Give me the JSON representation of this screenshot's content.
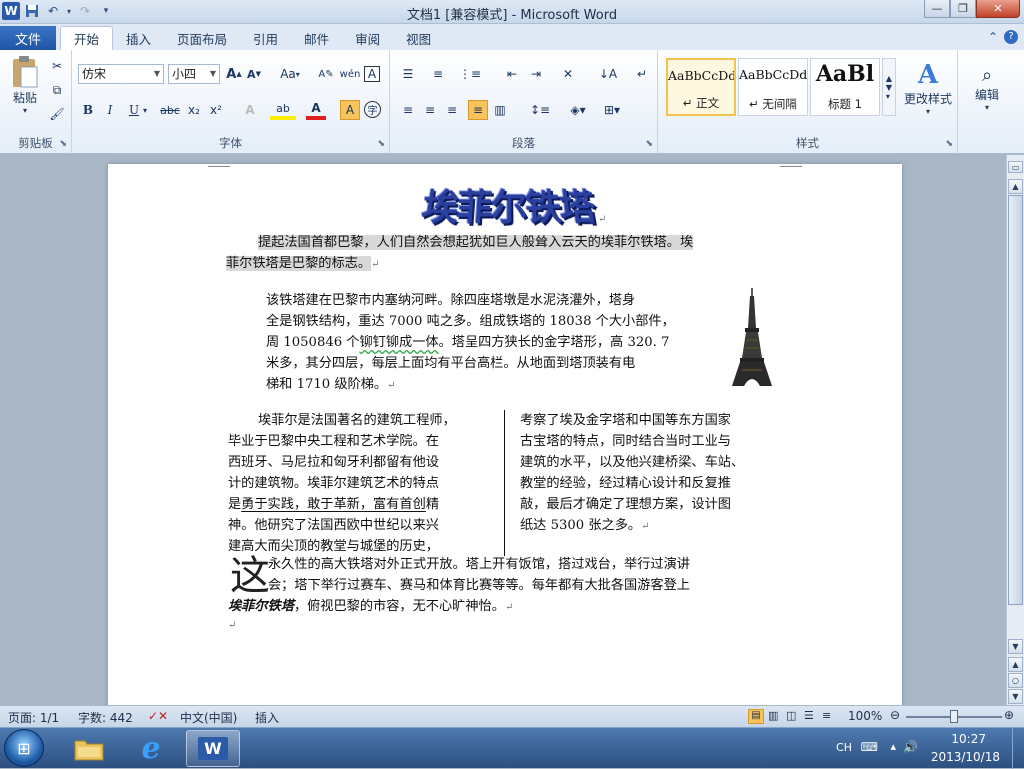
{
  "titlebar": {
    "title": "文档1 [兼容模式] - Microsoft Word",
    "app_letter": "W",
    "qat_icons": [
      "save-icon",
      "undo-icon",
      "redo-icon",
      "customize-icon"
    ]
  },
  "tabs": {
    "file": "文件",
    "items": [
      "开始",
      "插入",
      "页面布局",
      "引用",
      "邮件",
      "审阅",
      "视图"
    ],
    "active": "开始"
  },
  "ribbon": {
    "clipboard": {
      "label": "剪贴板",
      "paste": "粘贴"
    },
    "font": {
      "label": "字体",
      "font_name": "仿宋",
      "font_size": "小四",
      "grow": "A",
      "shrink": "A",
      "case": "Aa",
      "phonetic": "wén",
      "border_char": "A",
      "bold": "B",
      "italic": "I",
      "underline": "U",
      "strike": "abc",
      "subscript": "x₂",
      "superscript": "x²",
      "text_effect": "A",
      "highlight": "ab",
      "font_color": "A",
      "char_shading": "A",
      "enclose": "字"
    },
    "paragraph": {
      "label": "段落"
    },
    "styles": {
      "label": "样式",
      "items": [
        {
          "sample": "AaBbCcDd",
          "name": "↵ 正文"
        },
        {
          "sample": "AaBbCcDd",
          "name": "↵ 无间隔"
        },
        {
          "sample": "AaBl",
          "name": "标题 1"
        }
      ],
      "change_styles": "更改样式"
    },
    "editing": {
      "label": "编辑"
    }
  },
  "document": {
    "wordart_title": "埃菲尔铁塔",
    "para1_line1": "提起法国首都巴黎，人们自然会想起犹如巨人般耸入云天的埃菲尔铁塔。埃",
    "para1_line2": "菲尔铁塔是巴黎的标志。",
    "para2_lines": [
      "该铁塔建在巴黎市内塞纳河畔。除四座塔墩是水泥浇灌外，塔身",
      "全是钢铁结构，重达 7000 吨之多。组成铁塔的 18038 个大小部件，",
      "米多，其分四层，每层上面均有平台高栏。从地面到塔顶装有电",
      "梯和 1710 级阶梯。"
    ],
    "para2_line3_a": "周 1050846 个",
    "para2_line3_wavy": "铆钉铆成一体",
    "para2_line3_b": "。塔呈四方狭长的金字塔形，高 320. 7",
    "col1_lines": [
      "埃菲尔是法国著名的建筑工程师，",
      "毕业于巴黎中央工程和艺术学院。在",
      "西班牙、马尼拉和匈牙利都留有他设",
      "计的建筑物。埃菲尔建筑艺术的特点",
      "神。他研究了法国西欧中世纪以来兴",
      "建高大而尖顶的教堂与城堡的历史，"
    ],
    "col1_line5_a": "是",
    "col1_line5_u": "勇于实践，敢于革新，富有首创",
    "col1_line5_b": "精",
    "col2_lines": [
      "考察了埃及金字塔和中国等东方国家",
      "古宝塔的特点，同时结合当时工业与",
      "建筑的水平，以及他兴建桥梁、车站、",
      "教堂的经验，经过精心设计和反复推",
      "敲，最后才确定了理想方案，设计图",
      "纸达 5300 张之多。"
    ],
    "dropcap": "这",
    "para4_line1": "永久性的高大铁塔对外正式开放。塔上开有饭馆，搭过戏台，举行过演讲",
    "para4_line2": "会；塔下举行过赛车、赛马和体育比赛等等。每年都有大批各国游客登上",
    "para4_bold": "埃菲尔铁塔",
    "para4_line3": "，俯视巴黎的市容，无不心旷神怡。",
    "para_mark": "↵"
  },
  "statusbar": {
    "page": "页面: 1/1",
    "words": "字数: 442",
    "language": "中文(中国)",
    "insert_mode": "插入",
    "zoom": "100%"
  },
  "taskbar": {
    "ime": "CH",
    "time": "10:27",
    "date": "2013/10/18"
  }
}
